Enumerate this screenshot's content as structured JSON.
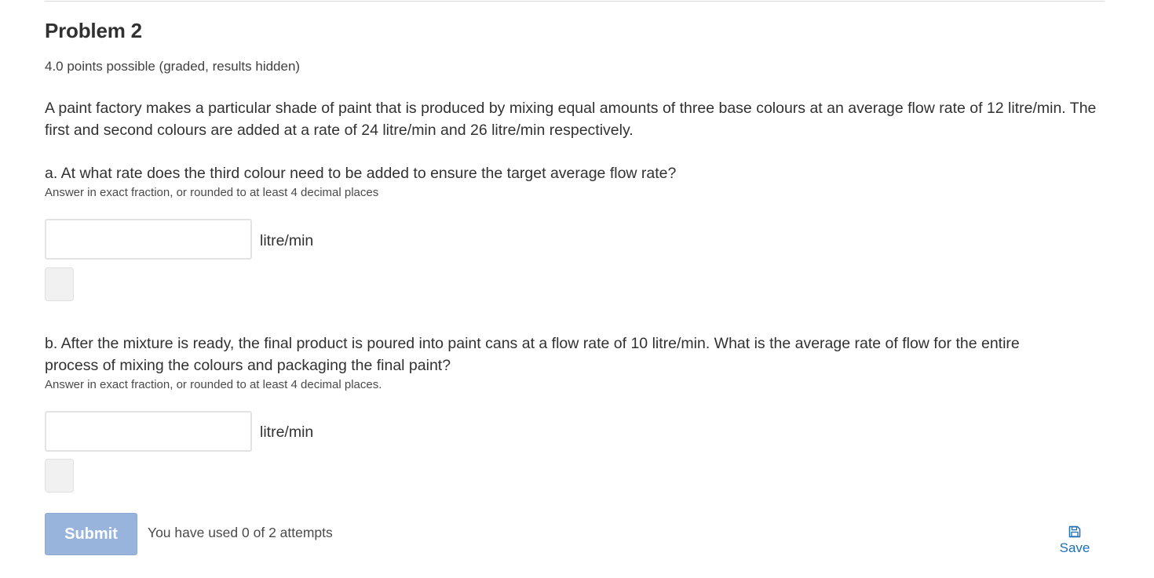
{
  "problem": {
    "title": "Problem 2",
    "points": "4.0 points possible (graded, results hidden)",
    "intro": "A paint factory makes a particular shade of paint that is produced by mixing equal amounts of three base colours at an average flow rate of 12 litre/min. The first and second colours are added at a rate of 24 litre/min and 26 litre/min respectively.",
    "parts": [
      {
        "question": "a. At what rate does the third colour need to be added to ensure the target average flow rate?",
        "hint": "Answer in exact fraction, or rounded to at least 4 decimal places",
        "value": "",
        "unit": "litre/min"
      },
      {
        "question": "b. After the mixture is ready, the final product is poured into paint cans at a flow rate of 10 litre/min. What is the average rate of flow for the entire process of mixing the colours and packaging the final paint?",
        "hint": "Answer in exact fraction, or rounded to at least 4 decimal places.",
        "value": "",
        "unit": "litre/min"
      }
    ]
  },
  "actions": {
    "submit_label": "Submit",
    "attempts_text": "You have used 0 of 2 attempts",
    "save_label": "Save",
    "save_icon": "floppy-disk-icon",
    "submit_color": "#98b4dc",
    "link_color": "#1f6fb5"
  }
}
